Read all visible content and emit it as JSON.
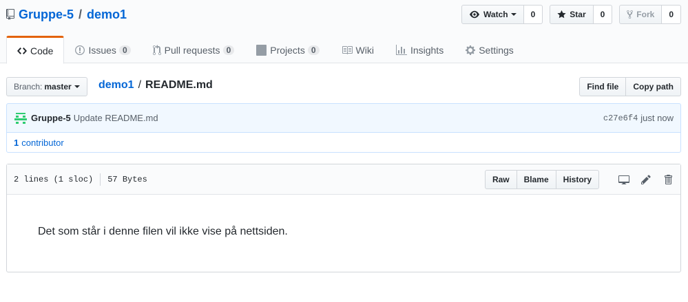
{
  "repo": {
    "owner": "Gruppe-5",
    "separator": "/",
    "name": "demo1"
  },
  "actions": {
    "watch_label": "Watch",
    "watch_count": "0",
    "star_label": "Star",
    "star_count": "0",
    "fork_label": "Fork",
    "fork_count": "0"
  },
  "tabs": [
    {
      "label": "Code",
      "icon": "code-icon"
    },
    {
      "label": "Issues",
      "count": "0",
      "icon": "issue-icon"
    },
    {
      "label": "Pull requests",
      "count": "0",
      "icon": "pull-request-icon"
    },
    {
      "label": "Projects",
      "count": "0",
      "icon": "project-icon"
    },
    {
      "label": "Wiki",
      "icon": "book-icon"
    },
    {
      "label": "Insights",
      "icon": "graph-icon"
    },
    {
      "label": "Settings",
      "icon": "gear-icon"
    }
  ],
  "file_nav": {
    "branch_label": "Branch:",
    "branch_value": "master",
    "breadcrumb_repo": "demo1",
    "breadcrumb_sep": "/",
    "breadcrumb_file": "README.md",
    "find_file": "Find file",
    "copy_path": "Copy path"
  },
  "commit": {
    "author": "Gruppe-5",
    "message": "Update README.md",
    "sha": "c27e6f4",
    "time": "just now"
  },
  "contributors": {
    "count": "1",
    "label": "contributor"
  },
  "file": {
    "lines": "2 lines (1 sloc)",
    "size": "57 Bytes",
    "raw": "Raw",
    "blame": "Blame",
    "history": "History",
    "content": "Det som står i denne filen vil ikke vise på nettsiden."
  },
  "colors": {
    "link": "#0366d6",
    "accent_tab": "#e36209",
    "commit_bg": "#f1f8ff",
    "avatar": "#2ecc71"
  }
}
